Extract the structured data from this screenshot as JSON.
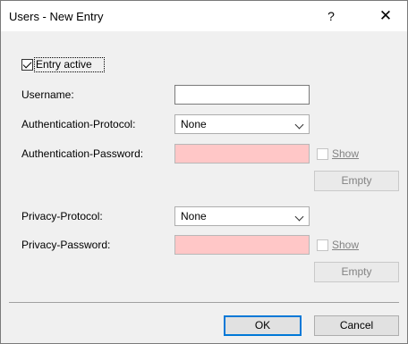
{
  "window": {
    "title": "Users - New Entry",
    "help_glyph": "?",
    "close_glyph": "✕"
  },
  "entry_active": {
    "label": "Entry active",
    "checked": true
  },
  "username": {
    "label": "Username:",
    "value": ""
  },
  "auth_protocol": {
    "label": "Authentication-Protocol:",
    "selected": "None"
  },
  "auth_password": {
    "label": "Authentication-Password:",
    "value": "",
    "show_label": "Show",
    "empty_label": "Empty"
  },
  "privacy_protocol": {
    "label": "Privacy-Protocol:",
    "selected": "None"
  },
  "privacy_password": {
    "label": "Privacy-Password:",
    "value": "",
    "show_label": "Show",
    "empty_label": "Empty"
  },
  "footer": {
    "ok_label": "OK",
    "cancel_label": "Cancel"
  }
}
